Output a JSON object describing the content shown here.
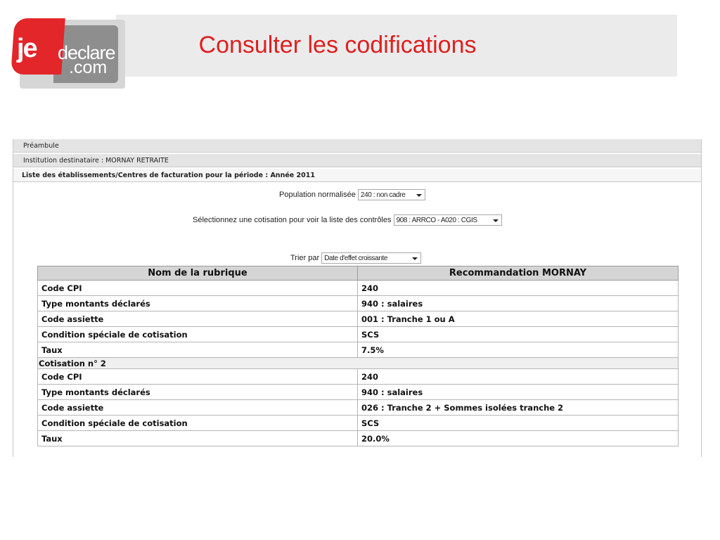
{
  "logo": {
    "je": "je",
    "declare": "declare",
    "com": ".com"
  },
  "page_title": "Consulter les codifications",
  "bars": {
    "preamble": "Préambule",
    "institution": "Institution destinataire : MORNAY RETRAITE",
    "establishments": "Liste des établissements/Centres de facturation pour la période : Année 2011"
  },
  "filters": {
    "population_label": "Population normalisée",
    "population_value": "240 : non cadre",
    "cotisation_label": "Sélectionnez une cotisation pour voir la liste des contrôles",
    "cotisation_value": "908 : ARRCO - A020 : CGIS",
    "sort_label": "Trier par",
    "sort_value": "Date d'effet croissante"
  },
  "table": {
    "headers": [
      "Nom de la rubrique",
      "Recommandation MORNAY"
    ],
    "block1": [
      [
        "Code CPI",
        "240"
      ],
      [
        "Type montants déclarés",
        "940 : salaires"
      ],
      [
        "Code assiette",
        "001 : Tranche 1 ou A"
      ],
      [
        "Condition spéciale de cotisation",
        "SCS"
      ],
      [
        "Taux",
        "7.5%"
      ]
    ],
    "section2": "Cotisation n° 2",
    "block2": [
      [
        "Code CPI",
        "240"
      ],
      [
        "Type montants déclarés",
        "940 : salaires"
      ],
      [
        "Code assiette",
        "026 : Tranche 2 + Sommes isolées tranche 2"
      ],
      [
        "Condition spéciale de cotisation",
        "SCS"
      ],
      [
        "Taux",
        "20.0%"
      ]
    ]
  }
}
